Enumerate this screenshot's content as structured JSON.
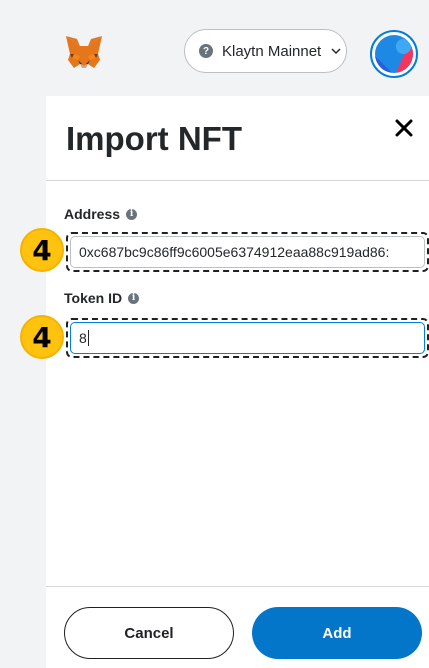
{
  "header": {
    "network_name": "Klaytn Mainnet",
    "network_icon_glyph": "?"
  },
  "dialog": {
    "title": "Import NFT",
    "address_label": "Address",
    "address_value": "0xc687bc9c86ff9c6005e6374912eaa88c919ad86:",
    "token_id_label": "Token ID",
    "token_id_value": "8",
    "info_glyph": "i",
    "cancel_label": "Cancel",
    "add_label": "Add"
  },
  "annotations": {
    "step_address": "4",
    "step_token": "4"
  },
  "colors": {
    "primary": "#0376c9",
    "step_badge": "#ffc20e"
  }
}
